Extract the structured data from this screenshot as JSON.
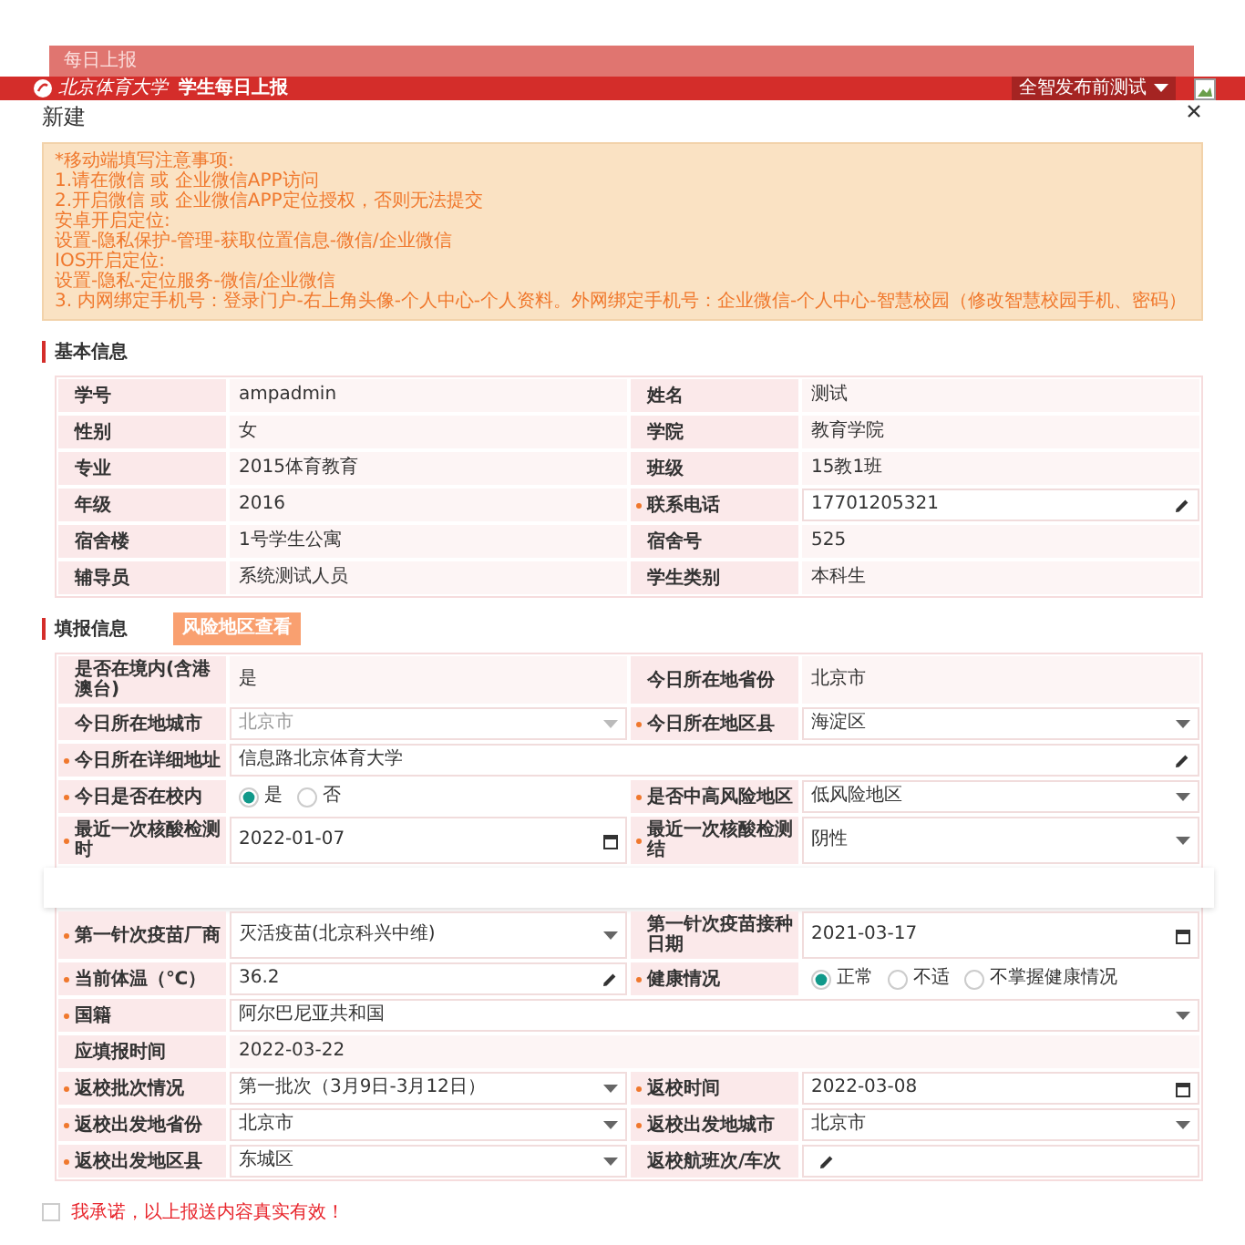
{
  "top_tab": {
    "title": "每日上报"
  },
  "header": {
    "logo_text": "北京体育大学",
    "app_title": "学生每日上报",
    "user": "全智发布前测试"
  },
  "dialog": {
    "title": "新建"
  },
  "notice": {
    "lines": [
      "*移动端填写注意事项:",
      "1.请在微信 或 企业微信APP访问",
      "2.开启微信 或 企业微信APP定位授权，否则无法提交",
      "安卓开启定位:",
      "设置-隐私保护-管理-获取位置信息-微信/企业微信",
      "IOS开启定位:",
      "设置-隐私-定位服务-微信/企业微信",
      "3. 内网绑定手机号：登录门户-右上角头像-个人中心-个人资料。外网绑定手机号：企业微信-个人中心-智慧校园（修改智慧校园手机、密码）"
    ]
  },
  "basic_info": {
    "title": "基本信息",
    "rows": [
      [
        {
          "label": "学号",
          "value": "ampadmin",
          "kind": "text",
          "required": false
        },
        {
          "label": "姓名",
          "value": "测试",
          "kind": "text",
          "required": false
        }
      ],
      [
        {
          "label": "性别",
          "value": "女",
          "kind": "text",
          "required": false
        },
        {
          "label": "学院",
          "value": "教育学院",
          "kind": "text",
          "required": false
        }
      ],
      [
        {
          "label": "专业",
          "value": "2015体育教育",
          "kind": "text",
          "required": false
        },
        {
          "label": "班级",
          "value": "15教1班",
          "kind": "text",
          "required": false
        }
      ],
      [
        {
          "label": "年级",
          "value": "2016",
          "kind": "text",
          "required": false
        },
        {
          "label": "联系电话",
          "value": "17701205321",
          "kind": "input",
          "required": true
        }
      ],
      [
        {
          "label": "宿舍楼",
          "value": "1号学生公寓",
          "kind": "text",
          "required": false
        },
        {
          "label": "宿舍号",
          "value": "525",
          "kind": "text",
          "required": false
        }
      ],
      [
        {
          "label": "辅导员",
          "value": "系统测试人员",
          "kind": "text",
          "required": false
        },
        {
          "label": "学生类别",
          "value": "本科生",
          "kind": "text",
          "required": false
        }
      ]
    ]
  },
  "fill_info": {
    "title": "填报信息",
    "risk_button": "风险地区查看",
    "rows": [
      [
        {
          "label": "是否在境内(含港澳台)",
          "value": "是",
          "kind": "text",
          "required": false
        },
        {
          "label": "今日所在地省份",
          "value": "北京市",
          "kind": "text",
          "required": false
        }
      ],
      [
        {
          "label": "今日所在地城市",
          "value": "北京市",
          "kind": "select",
          "required": false,
          "disabled": true
        },
        {
          "label": "今日所在地区县",
          "value": "海淀区",
          "kind": "select",
          "required": true,
          "disabled": false
        }
      ],
      [
        {
          "label": "今日所在详细地址",
          "value": "信息路北京体育大学",
          "kind": "input",
          "required": true
        }
      ],
      [
        {
          "label": "今日是否在校内",
          "kind": "radio",
          "required": true,
          "options": [
            {
              "label": "是",
              "selected": true
            },
            {
              "label": "否",
              "selected": false
            }
          ]
        },
        {
          "label": "是否中高风险地区",
          "value": "低风险地区",
          "kind": "select",
          "required": true,
          "disabled": false
        }
      ],
      [
        {
          "label": "最近一次核酸检测时",
          "value": "2022-01-07",
          "kind": "date",
          "required": true
        },
        {
          "label": "最近一次核酸检测结",
          "value": "阴性",
          "kind": "select",
          "required": true,
          "disabled": false
        }
      ],
      [
        {
          "label": "第一针次疫苗厂商",
          "value": "灭活疫苗(北京科兴中维)",
          "kind": "select",
          "required": true,
          "disabled": false
        },
        {
          "label": "第一针次疫苗接种日期",
          "value": "2021-03-17",
          "kind": "date",
          "required": false
        }
      ],
      [
        {
          "label": "当前体温（℃）",
          "value": "36.2",
          "kind": "input",
          "required": true
        },
        {
          "label": "健康情况",
          "kind": "radio",
          "required": true,
          "options": [
            {
              "label": "正常",
              "selected": true
            },
            {
              "label": "不适",
              "selected": false
            },
            {
              "label": "不掌握健康情况",
              "selected": false
            }
          ]
        }
      ],
      [
        {
          "label": "国籍",
          "value": "阿尔巴尼亚共和国",
          "kind": "select",
          "required": true,
          "disabled": false
        }
      ],
      [
        {
          "label": "应填报时间",
          "value": "2022-03-22",
          "kind": "text",
          "required": false
        }
      ],
      [
        {
          "label": "返校批次情况",
          "value": "第一批次（3月9日-3月12日）",
          "kind": "select",
          "required": true,
          "disabled": false
        },
        {
          "label": "返校时间",
          "value": "2022-03-08",
          "kind": "date",
          "required": true
        }
      ],
      [
        {
          "label": "返校出发地省份",
          "value": "北京市",
          "kind": "select",
          "required": true,
          "disabled": false
        },
        {
          "label": "返校出发地城市",
          "value": "北京市",
          "kind": "select",
          "required": true,
          "disabled": false
        }
      ],
      [
        {
          "label": "返校出发地区县",
          "value": "东城区",
          "kind": "select",
          "required": true,
          "disabled": false
        },
        {
          "label": "返校航班次/车次",
          "kind": "input",
          "required": false
        }
      ]
    ]
  },
  "pledge": {
    "text": "我承诺，以上报送内容真实有效！",
    "checked": false
  }
}
